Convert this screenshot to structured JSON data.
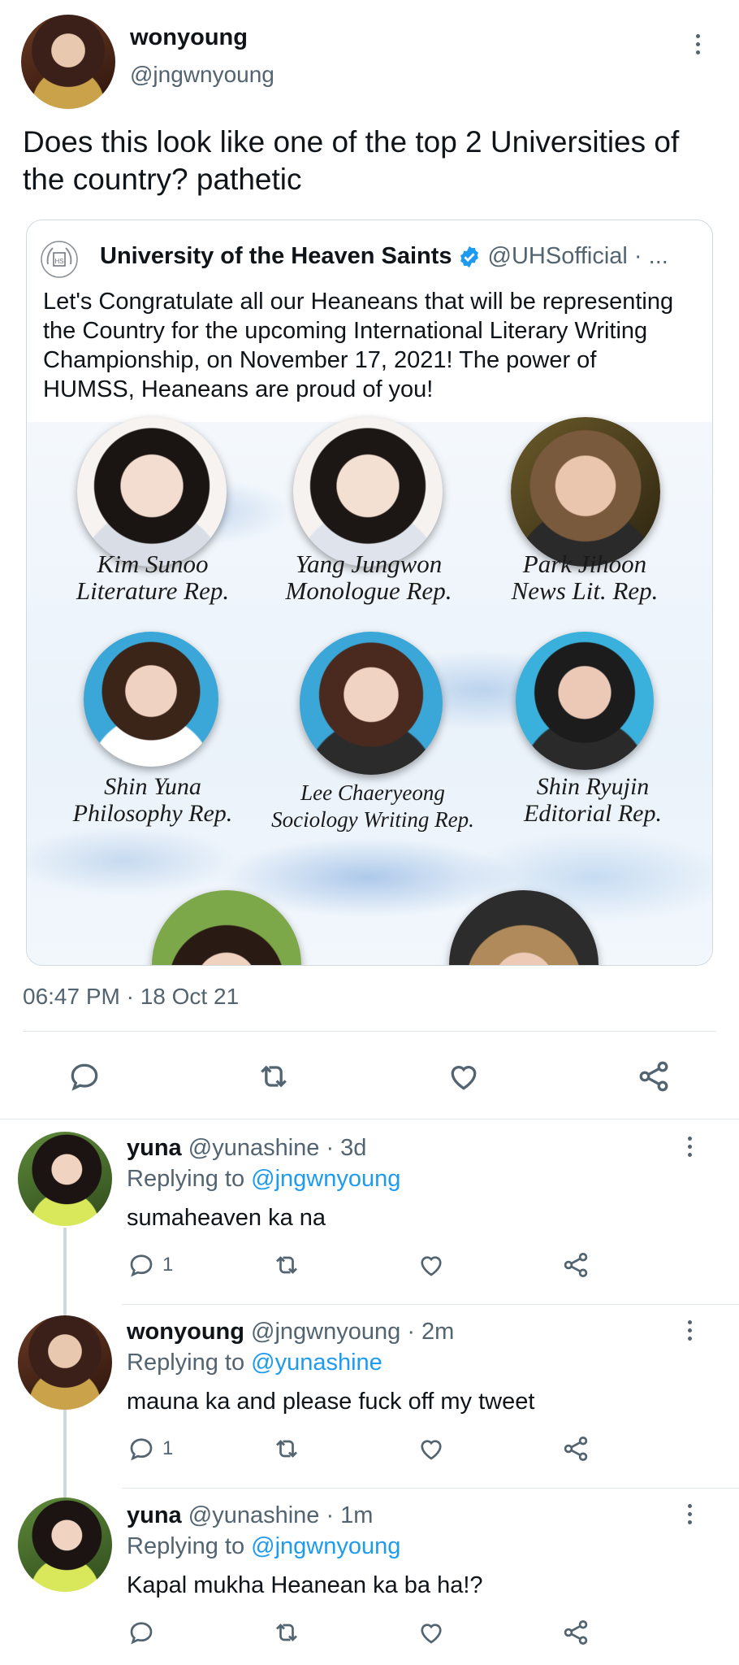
{
  "tweet": {
    "author_name": "wonyoung",
    "author_handle": "@jngwnyoung",
    "text": "Does this look like one of the top 2 Universities of the country? pathetic",
    "timestamp": "06:47 PM · 18 Oct 21"
  },
  "quoted": {
    "org_name": "University of the Heaven Saints",
    "org_handle": "@UHSofficial · ...",
    "text": "Let's Congratulate all our Heaneans that will be representing the Country for the upcoming International Literary Writing Championship, on November 17, 2021! The power of HUMSS, Heaneans are proud of you!",
    "people": [
      {
        "name": "Kim Sunoo",
        "role": "Literature Rep."
      },
      {
        "name": "Yang Jungwon",
        "role": "Monologue Rep."
      },
      {
        "name": "Park Jihoon",
        "role": "News Lit. Rep."
      },
      {
        "name": "Shin Yuna",
        "role": "Philosophy Rep."
      },
      {
        "name": "Lee Chaeryeong",
        "role": "Sociology Writing Rep."
      },
      {
        "name": "Shin Ryujin",
        "role": "Editorial Rep."
      }
    ]
  },
  "replies": [
    {
      "name": "yuna",
      "handle": "@yunashine",
      "time": "· 3d",
      "replying_label": "Replying to",
      "replying_to": "@jngwnyoung",
      "text": "sumaheaven ka na",
      "reply_count": "1"
    },
    {
      "name": "wonyoung",
      "handle": "@jngwnyoung",
      "time": "· 2m",
      "replying_label": "Replying to",
      "replying_to": "@yunashine",
      "text": "mauna ka and please fuck off my tweet",
      "reply_count": "1"
    },
    {
      "name": "yuna",
      "handle": "@yunashine",
      "time": "· 1m",
      "replying_label": "Replying to",
      "replying_to": "@jngwnyoung",
      "text": "Kapal mukha Heanean ka ba ha!?",
      "reply_count": ""
    }
  ],
  "colors": {
    "accent": "#1d9bf0",
    "muted": "#536471",
    "verified": "#1d9bf0"
  }
}
